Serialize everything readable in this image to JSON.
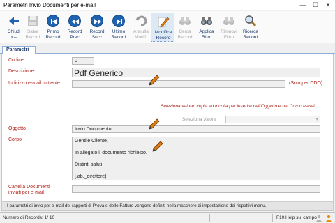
{
  "window": {
    "title": "Parametri Invio Documenti per e-mail",
    "minimize": "—",
    "maximize": "☐",
    "close": "✕"
  },
  "toolbar": {
    "buttons": [
      {
        "label": "Chiudi\n<--",
        "icon": "arrow-left-icon",
        "enabled": true
      },
      {
        "label": "Salva\nRecord",
        "icon": "save-icon",
        "enabled": false
      },
      {
        "label": "Primo\nRecord",
        "icon": "first-record-icon",
        "enabled": true
      },
      {
        "label": "Record\nPrec",
        "icon": "previous-record-icon",
        "enabled": true
      },
      {
        "label": "Record\nSucc",
        "icon": "next-record-icon",
        "enabled": true
      },
      {
        "label": "Ultimo\nRecord",
        "icon": "last-record-icon",
        "enabled": true
      },
      {
        "label": "Annulla\nModif.",
        "icon": "undo-icon",
        "enabled": false
      },
      {
        "label": "Modifica\nRecord",
        "icon": "edit-pencil-icon",
        "enabled": true,
        "active": true
      },
      {
        "label": "Cerca\nRecord",
        "icon": "binoculars-icon",
        "enabled": false
      },
      {
        "label": "Applica\nFiltro",
        "icon": "apply-filter-binoculars-icon",
        "enabled": true
      },
      {
        "label": "Rimuovi\nFiltro",
        "icon": "remove-filter-binoculars-icon",
        "enabled": false
      },
      {
        "label": "Ricerca\nRecord",
        "icon": "magnifier-icon",
        "enabled": true
      }
    ]
  },
  "tabs": [
    {
      "label": "Parametri",
      "selected": true
    }
  ],
  "form": {
    "codice": {
      "label": "Codice",
      "value": "0"
    },
    "descrizione": {
      "label": "Descrizione",
      "value": "Pdf Generico"
    },
    "indirizzo": {
      "label": "Indirizzo e-mail mittente",
      "value": "",
      "hint": "(Solo per CDO)"
    },
    "seleziona_note": "Seleziona valore: copia ed incolla per inserire nell'Oggetto e nel Corpo e-mail",
    "seleziona": {
      "label": "Seleziona Valore",
      "value": ""
    },
    "oggetto": {
      "label": "Oggetto",
      "value": "Invio Documento"
    },
    "corpo": {
      "label": "Corpo",
      "lines": [
        "Gentile Cliente,",
        "",
        "In allegato il documento richiesto.",
        "",
        "Distinti saluti",
        "",
        "[.ab._direttore]"
      ]
    },
    "cartella": {
      "label_line1": "Cartella Documenti",
      "label_line2": "inviati per e-mail",
      "value": ""
    },
    "info": "I parametri di invio per e-mail dei rapporti di Prova e delle Fatture vengono definiti nella maschere di impostazione dei rispettivi menu."
  },
  "status": {
    "records": "Numero di Records: 1/ 10",
    "help": "F10:Help sul campo"
  },
  "colors": {
    "label_red": "#b02018",
    "toolbar_blue": "#1e62b0",
    "tab_text": "#1a3a6e"
  }
}
